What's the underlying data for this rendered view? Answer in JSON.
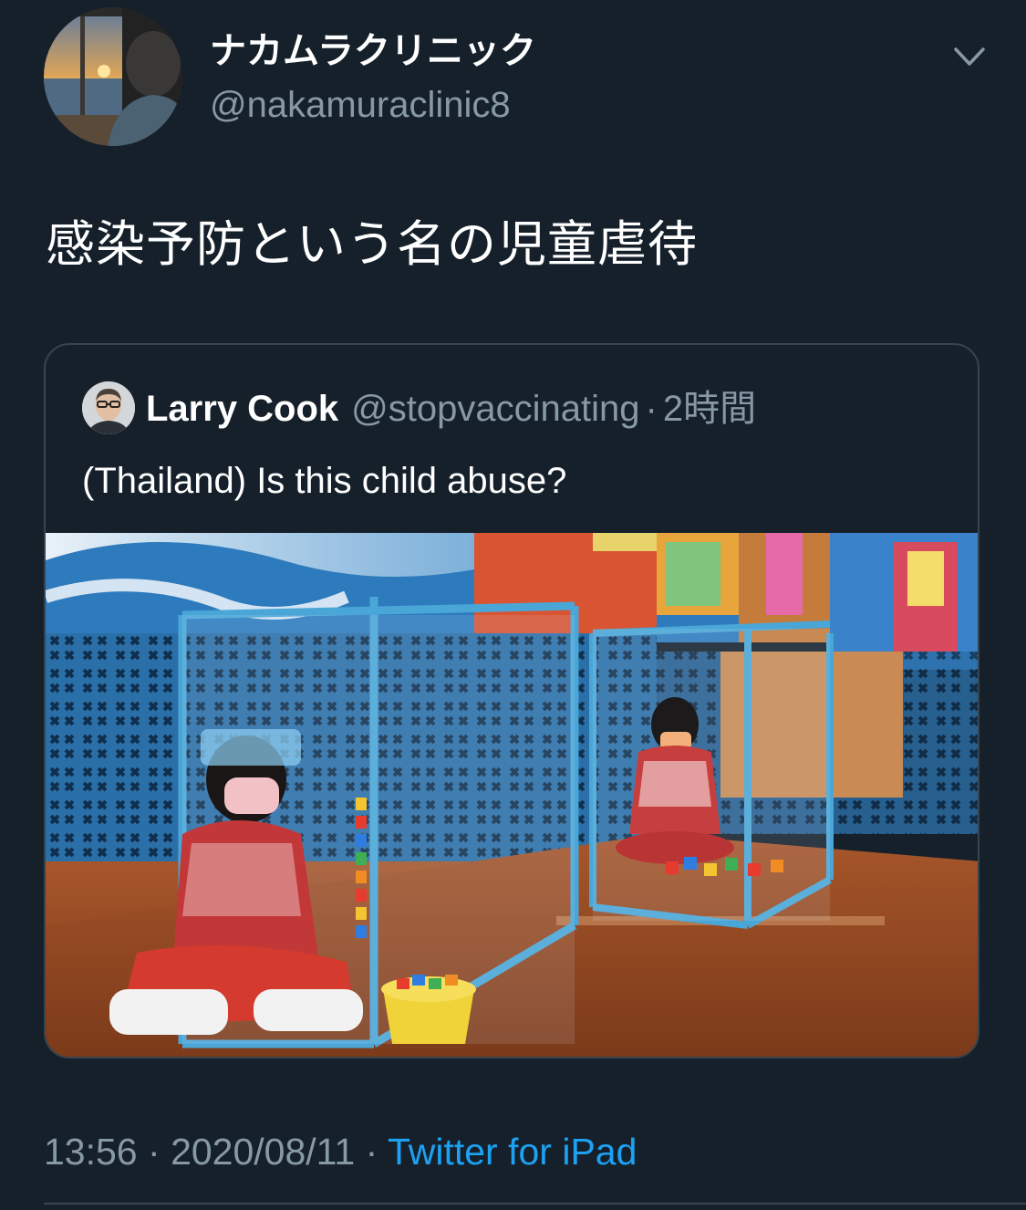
{
  "author": {
    "name": "ナカムラクリニック",
    "handle": "@nakamuraclinic8"
  },
  "tweet": {
    "text": "感染予防という名の児童虐待"
  },
  "quoted_tweet": {
    "name": "Larry Cook",
    "handle": "@stopvaccinating",
    "separator": "·",
    "time": "2時間",
    "text": "(Thailand) Is this child abuse?"
  },
  "meta": {
    "time": "13:56",
    "separator1": "·",
    "date": "2020/08/11",
    "separator2": "·",
    "source": "Twitter for iPad"
  },
  "icons": {
    "caret": "chevron-down-icon"
  },
  "colors": {
    "background": "#15202b",
    "secondary_text": "#8899a6",
    "accent": "#1da1f2",
    "border": "#38444d"
  }
}
